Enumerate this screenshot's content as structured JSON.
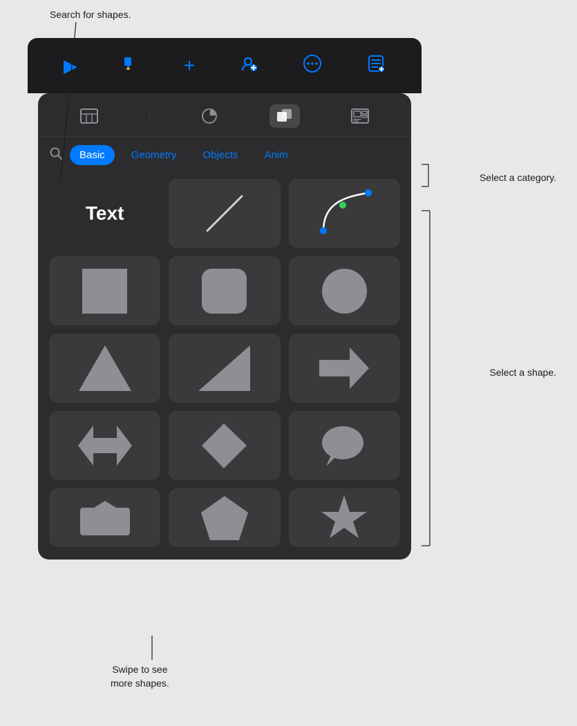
{
  "annotations": {
    "search_callout": "Search for shapes.",
    "category_callout": "Select a category.",
    "shape_callout": "Select a shape.",
    "swipe_callout": "Swipe to see\nmore shapes."
  },
  "toolbar": {
    "icons": [
      "play",
      "paintbrush",
      "plus",
      "add-person",
      "more",
      "list"
    ]
  },
  "panel_tabs": [
    {
      "label": "table",
      "icon": "⊞",
      "active": false
    },
    {
      "label": "chart",
      "icon": "◑",
      "active": false
    },
    {
      "label": "shape",
      "icon": "⬡",
      "active": true
    },
    {
      "label": "media",
      "icon": "⧉",
      "active": false
    }
  ],
  "categories": [
    {
      "label": "Basic",
      "active": true
    },
    {
      "label": "Geometry",
      "active": false
    },
    {
      "label": "Objects",
      "active": false
    },
    {
      "label": "Anim",
      "active": false
    }
  ],
  "shapes": {
    "row_special": [
      {
        "name": "Text",
        "type": "text"
      },
      {
        "name": "Line",
        "type": "line"
      },
      {
        "name": "Curve",
        "type": "curve"
      }
    ],
    "row1": [
      {
        "name": "Square",
        "type": "square"
      },
      {
        "name": "Rounded Rectangle",
        "type": "rounded-rect"
      },
      {
        "name": "Circle",
        "type": "circle"
      }
    ],
    "row2": [
      {
        "name": "Triangle",
        "type": "triangle"
      },
      {
        "name": "Right Triangle",
        "type": "right-triangle"
      },
      {
        "name": "Arrow",
        "type": "arrow"
      }
    ],
    "row3": [
      {
        "name": "Double Arrow",
        "type": "double-arrow"
      },
      {
        "name": "Diamond",
        "type": "diamond"
      },
      {
        "name": "Speech Bubble",
        "type": "speech-bubble"
      }
    ],
    "row4": [
      {
        "name": "Shape 1",
        "type": "partial-1"
      },
      {
        "name": "Pentagon",
        "type": "pentagon"
      },
      {
        "name": "Star",
        "type": "star"
      }
    ]
  }
}
